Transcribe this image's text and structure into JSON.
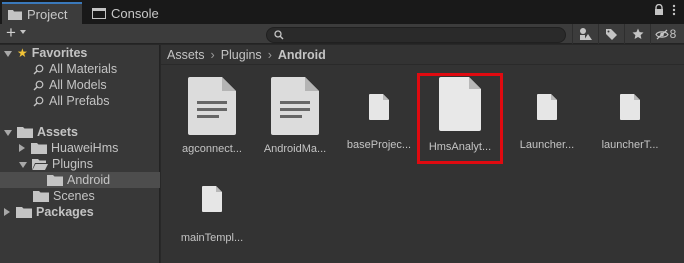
{
  "tabs": [
    {
      "label": "Project",
      "icon": "folder-icon",
      "active": true
    },
    {
      "label": "Console",
      "icon": "console-icon",
      "active": false
    }
  ],
  "toolbar": {
    "add_label": "+",
    "search_placeholder": "",
    "hidden_count": "8"
  },
  "tree": {
    "favorites": {
      "label": "Favorites",
      "items": [
        "All Materials",
        "All Models",
        "All Prefabs"
      ]
    },
    "assets": {
      "label": "Assets",
      "children": [
        "HuaweiHms",
        "Plugins",
        "Android",
        "Scenes"
      ]
    },
    "packages": {
      "label": "Packages"
    }
  },
  "breadcrumb": [
    "Assets",
    "Plugins",
    "Android"
  ],
  "files": [
    {
      "label": "agconnect...",
      "kind": "text-doc"
    },
    {
      "label": "AndroidMa...",
      "kind": "text-doc"
    },
    {
      "label": "baseProjec...",
      "kind": "blank-doc"
    },
    {
      "label": "HmsAnalyt...",
      "kind": "blank-doc-large",
      "highlighted": true
    },
    {
      "label": "Launcher...",
      "kind": "blank-doc"
    },
    {
      "label": "launcherT...",
      "kind": "blank-doc"
    },
    {
      "label": "mainTempl...",
      "kind": "blank-doc"
    }
  ],
  "colors": {
    "accent": "#3a79bb",
    "highlight": "#e00a10",
    "star": "#f2c437"
  }
}
